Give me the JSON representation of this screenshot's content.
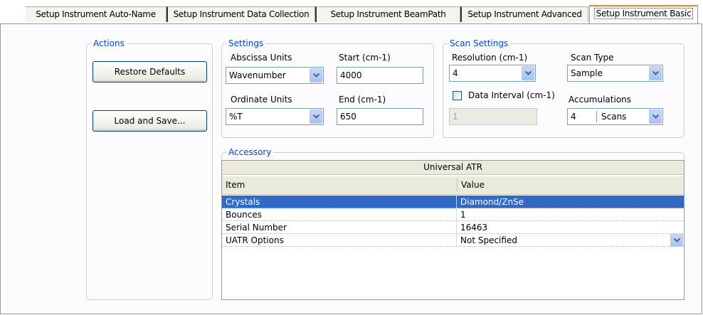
{
  "tabs": [
    {
      "label": "Setup Instrument Auto-Name"
    },
    {
      "label": "Setup Instrument Data Collection"
    },
    {
      "label": "Setup Instrument BeamPath"
    },
    {
      "label": "Setup Instrument Advanced"
    },
    {
      "label": "Setup Instrument Basic"
    }
  ],
  "actions": {
    "title": "Actions",
    "restore_label": "Restore Defaults",
    "load_save_label": "Load and Save..."
  },
  "settings": {
    "title": "Settings",
    "abscissa_label": "Abscissa Units",
    "abscissa_value": "Wavenumber",
    "start_label": "Start (cm-1)",
    "start_value": "4000",
    "ordinate_label": "Ordinate Units",
    "ordinate_value": "%T",
    "end_label": "End (cm-1)",
    "end_value": "650"
  },
  "scan": {
    "title": "Scan Settings",
    "resolution_label": "Resolution (cm-1)",
    "resolution_value": "4",
    "scan_type_label": "Scan Type",
    "scan_type_value": "Sample",
    "data_interval_label": "Data Interval (cm-1)",
    "data_interval_value": "1",
    "accumulations_label": "Accumulations",
    "accumulations_value": "4",
    "accumulations_unit": "Scans"
  },
  "accessory": {
    "title": "Accessory",
    "name": "Universal ATR",
    "col_item": "Item",
    "col_value": "Value",
    "rows": [
      {
        "item": "Crystals",
        "value": "Diamond/ZnSe"
      },
      {
        "item": "Bounces",
        "value": "1"
      },
      {
        "item": "Serial Number",
        "value": "16463"
      },
      {
        "item": "UATR Options",
        "value": "Not Specified"
      }
    ]
  },
  "colors": {
    "accent": "#0046d5",
    "selection": "#316ac5",
    "active_tab_highlight": "#e68b2c"
  }
}
